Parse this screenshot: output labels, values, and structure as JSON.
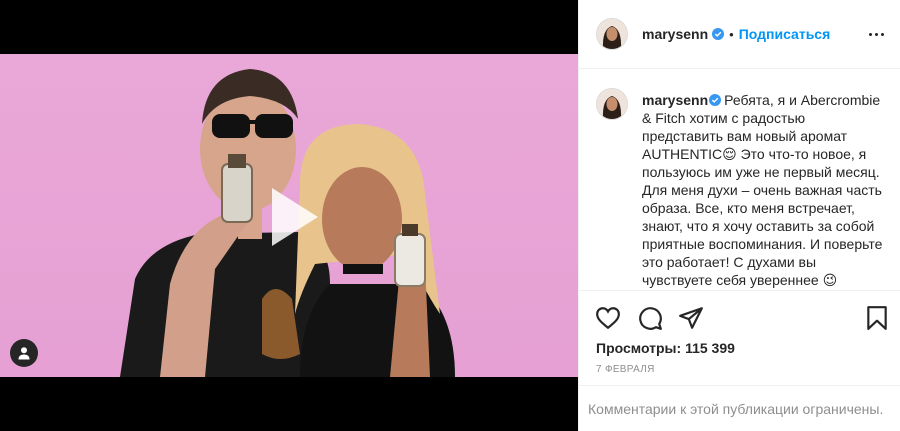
{
  "post": {
    "username": "marysenn",
    "follow_label": "Подписаться",
    "dot": "•",
    "caption": "Ребята, я и Abercrombie & Fitch хотим с радостью представить вам новый аромат AUTHENTIC😌 Это что-то новое, я пользуюсь им уже не первый месяц. Для меня духи – очень важная часть образа. Все, кто меня встречает, знают, что я хочу оставить за собой приятные воспоминания. И поверьте это работает! С духами вы чувствуете себя увереннее 😉 Парфюм AUTHENTIC помогает мне",
    "views_label": "Просмотры:",
    "views_count": "115 399",
    "date": "7 февраля",
    "comments_limited": "Комментарии к этой публикации ограничены."
  },
  "icons": {
    "verified": "verified-badge-icon",
    "more": "more-options-icon",
    "like": "heart-icon",
    "comment": "comment-icon",
    "share": "share-icon",
    "save": "bookmark-icon",
    "play": "play-icon",
    "tags": "user-tag-icon"
  },
  "colors": {
    "accent": "#0095f6",
    "text": "#262626",
    "muted": "#8e8e8e",
    "video_bg": "#e6a0d3"
  }
}
